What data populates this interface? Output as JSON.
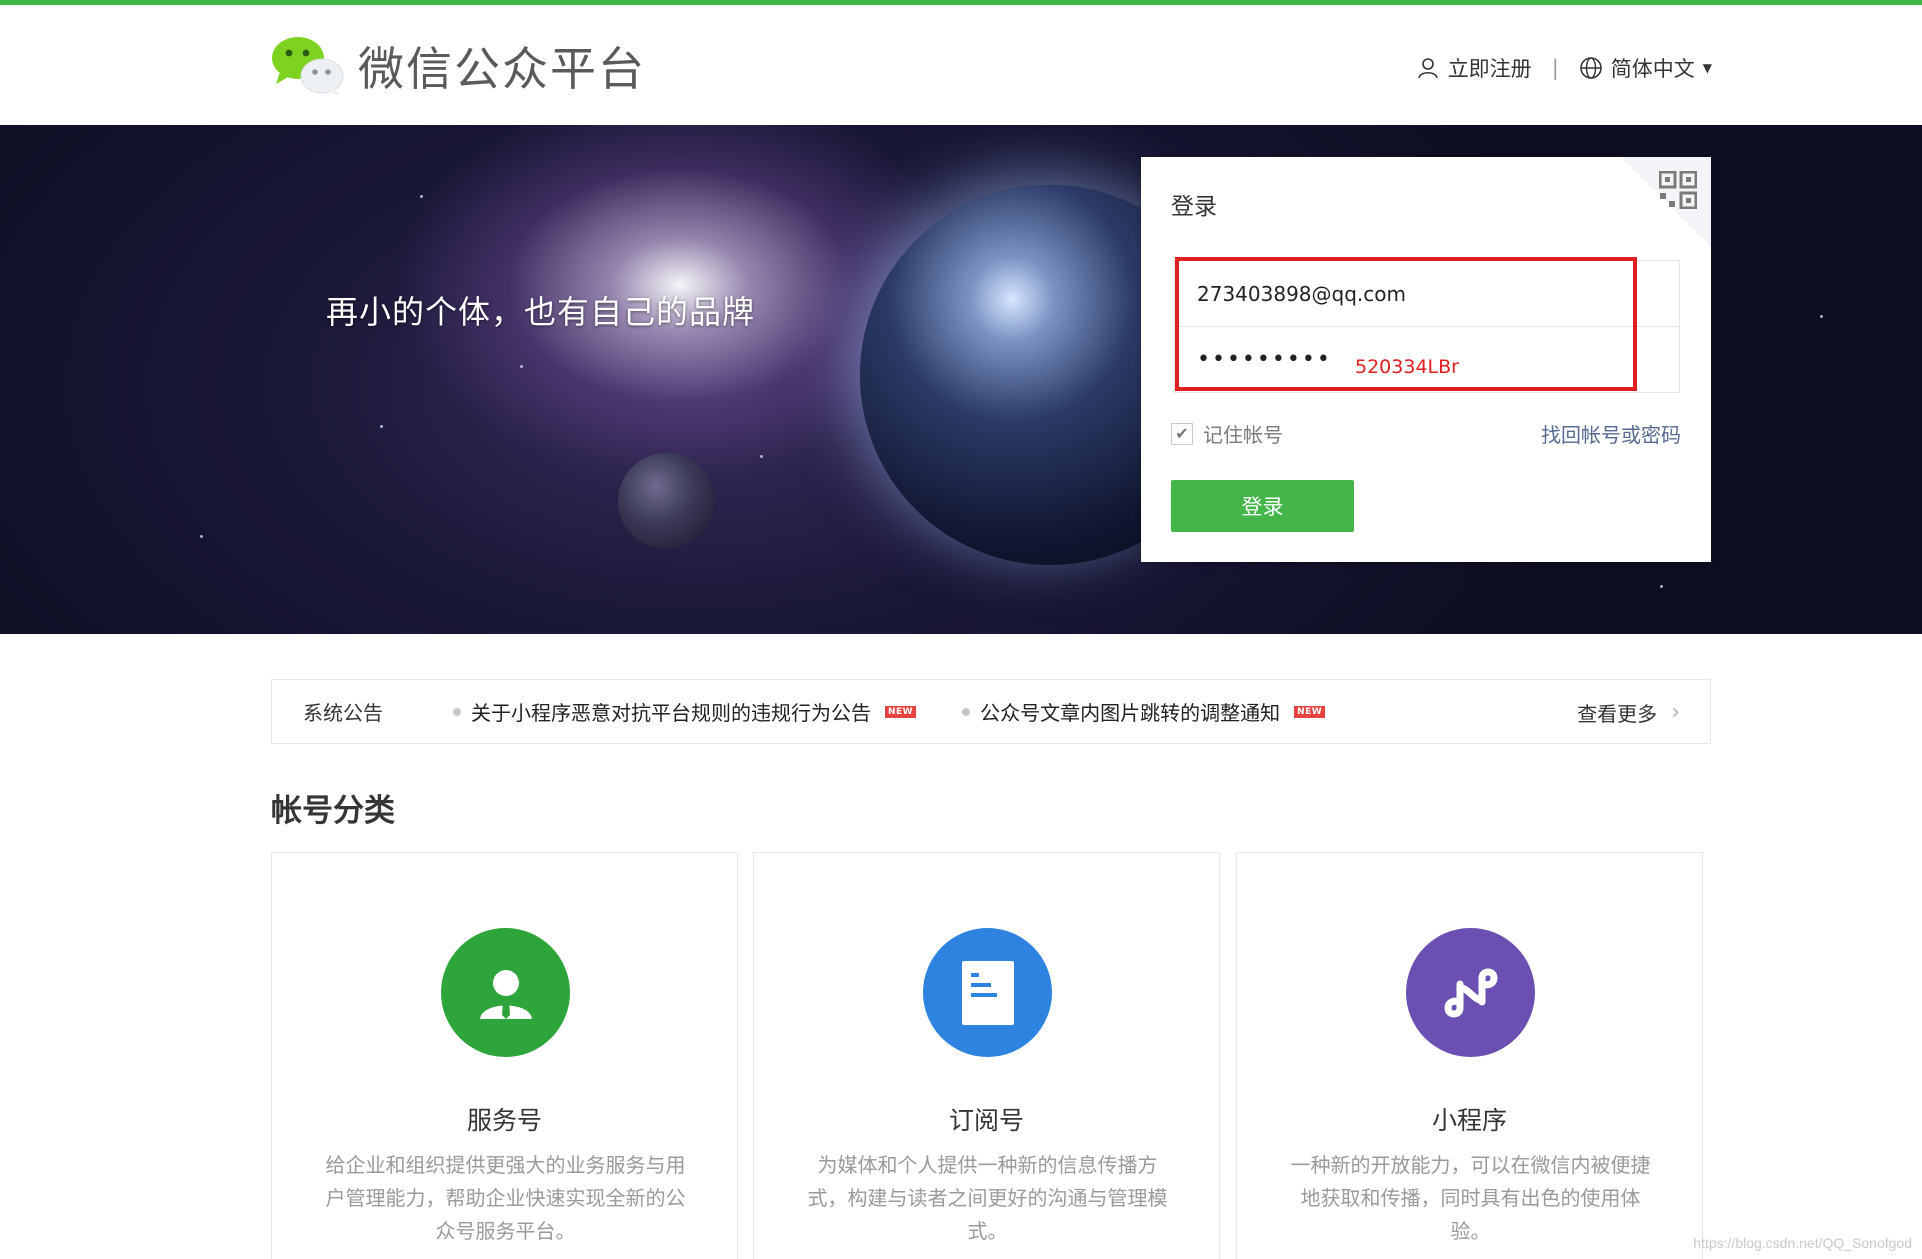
{
  "header": {
    "brand": "微信公众平台",
    "register_label": "立即注册",
    "separator": "|",
    "language_label": "简体中文"
  },
  "banner": {
    "slogan": "再小的个体，也有自己的品牌"
  },
  "login": {
    "title": "登录",
    "username_value": "273403898@qq.com",
    "password_value": "•••••••••",
    "password_annotation": "520334LBr",
    "remember_label": "记住帐号",
    "remember_checked": true,
    "forgot_label": "找回帐号或密码",
    "submit_label": "登录"
  },
  "notice": {
    "label": "系统公告",
    "items": [
      {
        "text": "关于小程序恶意对抗平台规则的违规行为公告",
        "badge": "NEW"
      },
      {
        "text": "公众号文章内图片跳转的调整通知",
        "badge": "NEW"
      }
    ],
    "more_label": "查看更多"
  },
  "accounts": {
    "section_title": "帐号分类",
    "cards": [
      {
        "title": "服务号",
        "desc": "给企业和组织提供更强大的业务服务与用户管理能力，帮助企业快速实现全新的公众号服务平台。",
        "icon": "service-account-icon",
        "color": "#2ea53a"
      },
      {
        "title": "订阅号",
        "desc": "为媒体和个人提供一种新的信息传播方式，构建与读者之间更好的沟通与管理模式。",
        "icon": "subscription-account-icon",
        "color": "#2e82e0"
      },
      {
        "title": "小程序",
        "desc": "一种新的开放能力，可以在微信内被便捷地获取和传播，同时具有出色的使用体验。",
        "icon": "mini-program-icon",
        "color": "#6b4fb3"
      }
    ]
  },
  "watermark": "https://blog.csdn.net/QQ_Sonofgod",
  "colors": {
    "brand_green": "#44b549",
    "link_blue": "#576b95",
    "annotation_red": "#e02020"
  }
}
